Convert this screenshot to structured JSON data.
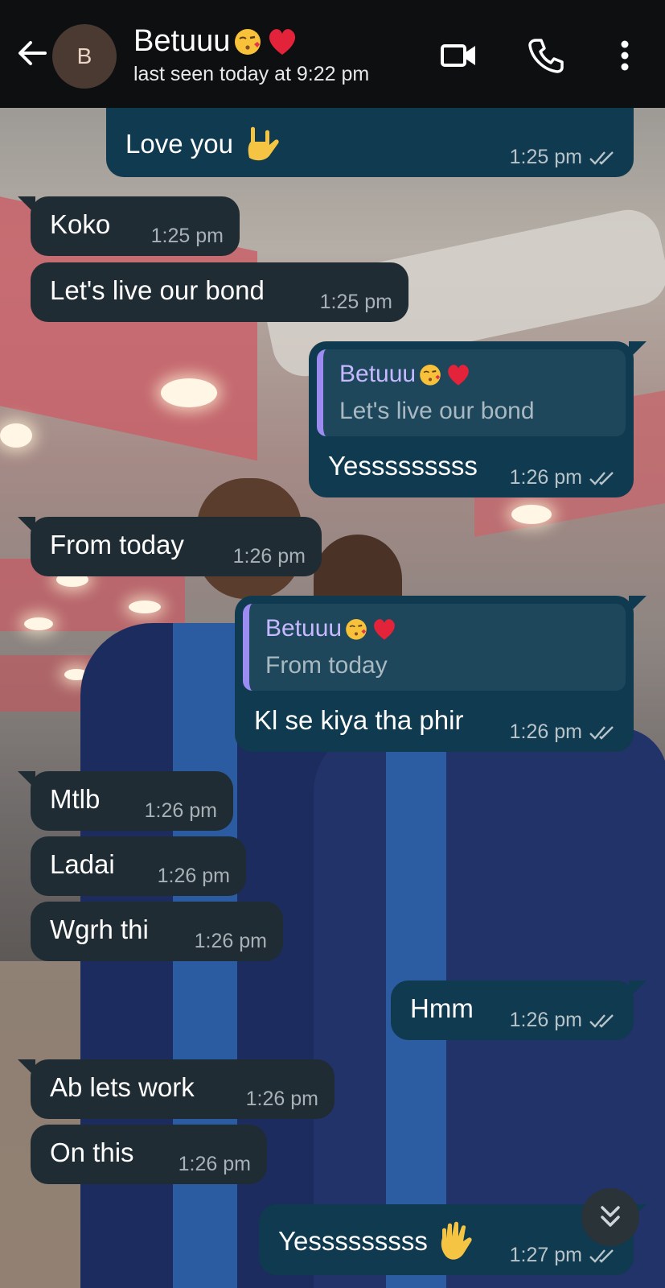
{
  "header": {
    "avatar_letter": "B",
    "contact_name": "Betuuu",
    "status": "last seen today at 9:22 pm",
    "icons": [
      "back-arrow-icon",
      "video-call-icon",
      "voice-call-icon",
      "more-options-icon"
    ]
  },
  "colors": {
    "header_bg": "#0d0f11",
    "incoming_bubble": "#1f2c34",
    "outgoing_bubble": "#0f3a4f",
    "quote_accent": "#9c8cf2"
  },
  "messages": [
    {
      "dir": "out",
      "text": "Love you",
      "emoji": "love-you-gesture-emoji",
      "time": "1:25 pm"
    },
    {
      "dir": "in",
      "text": "Koko",
      "time": "1:25 pm"
    },
    {
      "dir": "in",
      "text": "Let's live our bond",
      "time": "1:25 pm"
    },
    {
      "dir": "out",
      "reply_to": {
        "name": "Betuuu",
        "text": "Let's live our bond"
      },
      "text": "Yesssssssss",
      "time": "1:26 pm"
    },
    {
      "dir": "in",
      "text": "From today",
      "time": "1:26 pm"
    },
    {
      "dir": "out",
      "reply_to": {
        "name": "Betuuu",
        "text": "From today"
      },
      "text": "Kl se kiya tha phir",
      "time": "1:26 pm"
    },
    {
      "dir": "in",
      "text": "Mtlb",
      "time": "1:26 pm"
    },
    {
      "dir": "in",
      "text": "Ladai",
      "time": "1:26 pm"
    },
    {
      "dir": "in",
      "text": "Wgrh thi",
      "time": "1:26 pm"
    },
    {
      "dir": "out",
      "text": "Hmm",
      "time": "1:26 pm"
    },
    {
      "dir": "in",
      "text": "Ab lets work",
      "time": "1:26 pm"
    },
    {
      "dir": "in",
      "text": "On this",
      "time": "1:26 pm"
    },
    {
      "dir": "out",
      "text": "Yesssssssss",
      "emoji": "raised-hand-emoji",
      "time": "1:27 pm"
    }
  ]
}
